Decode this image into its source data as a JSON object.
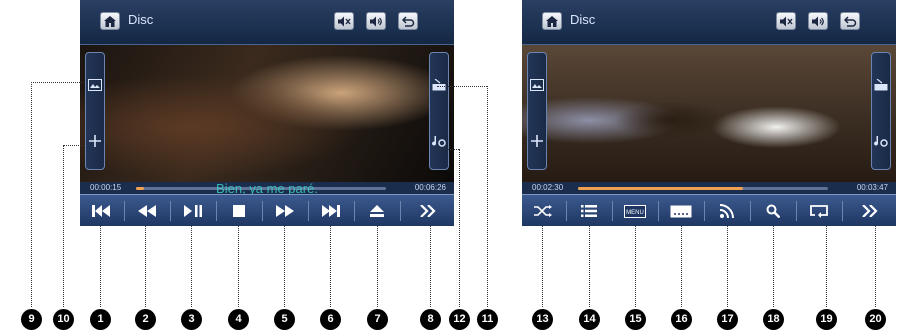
{
  "left": {
    "title": "Disc",
    "time_elapsed": "00:00:15",
    "time_total": "00:06:26",
    "progress": 0.03,
    "subtitle": "Bien, ya me paré."
  },
  "right": {
    "title": "Disc",
    "time_elapsed": "00:02:30",
    "time_total": "00:03:47",
    "progress": 0.66
  },
  "callouts": [
    "9",
    "10",
    "1",
    "2",
    "3",
    "4",
    "5",
    "6",
    "7",
    "8",
    "12",
    "11",
    "13",
    "14",
    "15",
    "16",
    "17",
    "18",
    "19",
    "20"
  ],
  "icons": {
    "home": "home-icon",
    "mute": "mute-icon",
    "volume": "volume-icon",
    "back": "back-icon",
    "prev": "skip-previous-icon",
    "rewind": "rewind-icon",
    "play_pause": "play-pause-icon",
    "stop": "stop-icon",
    "forward": "fast-forward-icon",
    "next": "skip-next-icon",
    "eject": "eject-icon",
    "more": "more-icon",
    "shuffle": "shuffle-icon",
    "list": "list-icon",
    "menu": "menu-icon",
    "subtitles": "subtitles-icon",
    "audio": "audio-icon",
    "search": "search-icon",
    "repeat": "repeat-icon"
  },
  "menu_button_label": "MENU",
  "colors": {
    "bar": "#1d3560",
    "progress": "#f0a050",
    "subtitle": "#3fd0c6"
  }
}
